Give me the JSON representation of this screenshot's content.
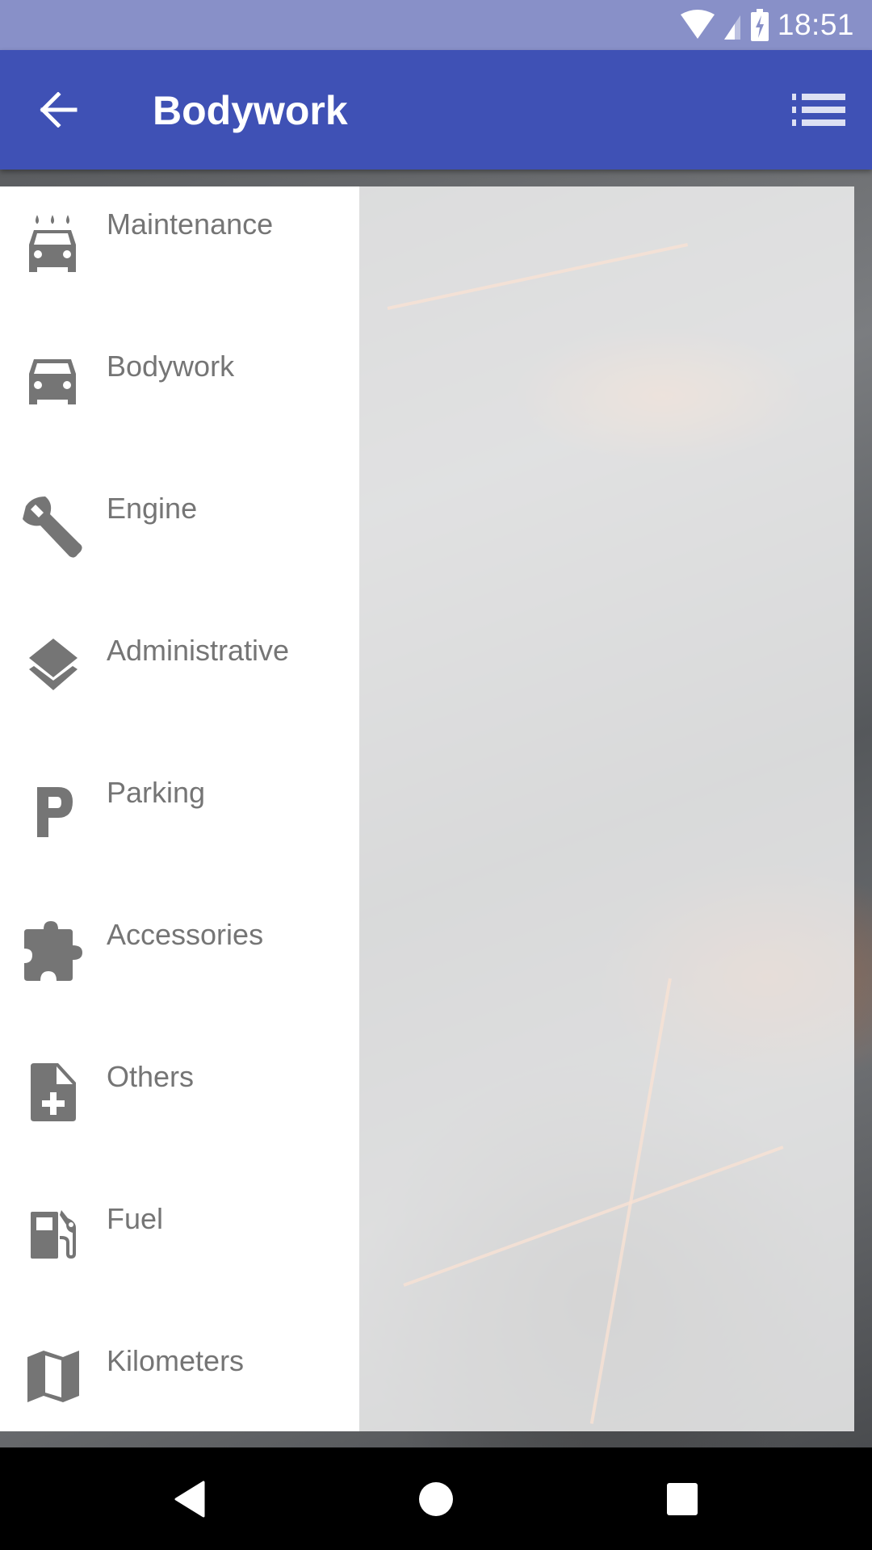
{
  "status_bar": {
    "time": "18:51",
    "icons": [
      "wifi-icon",
      "cellular-signal-icon",
      "battery-charging-icon"
    ],
    "background_color": "#8890C8"
  },
  "app_bar": {
    "title": "Bodywork",
    "back_icon": "arrow-back-icon",
    "action_icon": "list-icon",
    "background_color": "#3F51B5"
  },
  "drawer": {
    "items": [
      {
        "label": "Maintenance",
        "icon": "car-wash-icon"
      },
      {
        "label": "Bodywork",
        "icon": "car-icon"
      },
      {
        "label": "Engine",
        "icon": "wrench-icon"
      },
      {
        "label": "Administrative",
        "icon": "layers-icon"
      },
      {
        "label": "Parking",
        "icon": "parking-icon"
      },
      {
        "label": "Accessories",
        "icon": "puzzle-icon"
      },
      {
        "label": "Others",
        "icon": "note-add-icon"
      },
      {
        "label": "Fuel",
        "icon": "gas-station-icon"
      },
      {
        "label": "Kilometers",
        "icon": "map-icon"
      }
    ],
    "icon_color": "#757575",
    "text_color": "#757575"
  },
  "nav_bar": {
    "buttons": [
      "back-triangle-icon",
      "home-circle-icon",
      "recents-square-icon"
    ]
  }
}
